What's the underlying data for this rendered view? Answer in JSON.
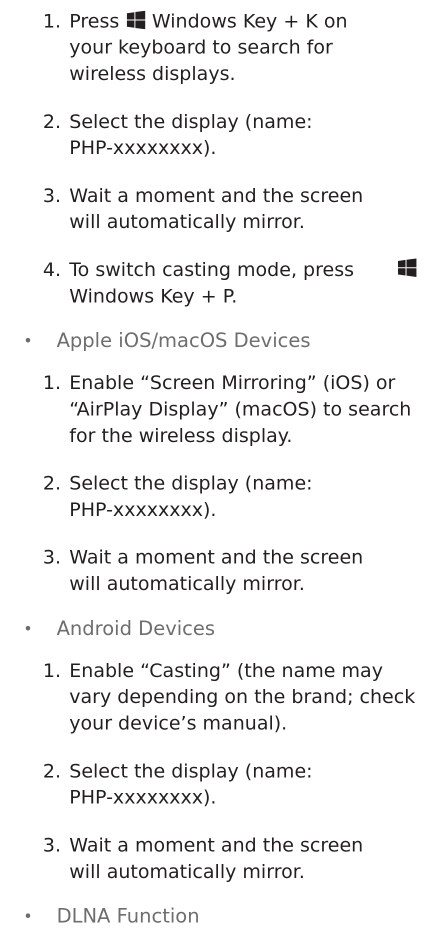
{
  "windows": {
    "steps": [
      {
        "num": "1.",
        "before": "Press ",
        "after": " Windows Key + K on your keyboard to search for wireless displays."
      },
      {
        "num": "2.",
        "text": "Select the display (name: PHP-xxxxxxxx)."
      },
      {
        "num": "3.",
        "text": "Wait a moment and the screen will automatically mirror."
      },
      {
        "num": "4.",
        "text": "To switch casting mode, press Windows Key + P."
      }
    ],
    "icon": "windows-logo-icon"
  },
  "apple": {
    "bullet": "•",
    "heading": "Apple iOS/macOS Devices",
    "steps": [
      {
        "num": "1.",
        "text": "Enable “Screen Mirroring” (iOS) or “AirPlay Display” (macOS) to search for the wireless display."
      },
      {
        "num": "2.",
        "text": "Select the display (name: PHP-xxxxxxxx)."
      },
      {
        "num": "3.",
        "text": "Wait a moment and the screen will automatically mirror."
      }
    ]
  },
  "android": {
    "bullet": "•",
    "heading": "Android Devices",
    "steps": [
      {
        "num": "1.",
        "text": "Enable “Casting” (the name may vary depending on the brand; check your device’s manual)."
      },
      {
        "num": "2.",
        "text": "Select the display (name: PHP-xxxxxxxx)."
      },
      {
        "num": "3.",
        "text": "Wait a moment and the screen will automatically mirror."
      }
    ]
  },
  "dlna": {
    "bullet": "•",
    "heading": "DLNA Function"
  },
  "colors": {
    "text": "#231f20",
    "heading": "#6e6e6e",
    "icon": "#231f20"
  }
}
